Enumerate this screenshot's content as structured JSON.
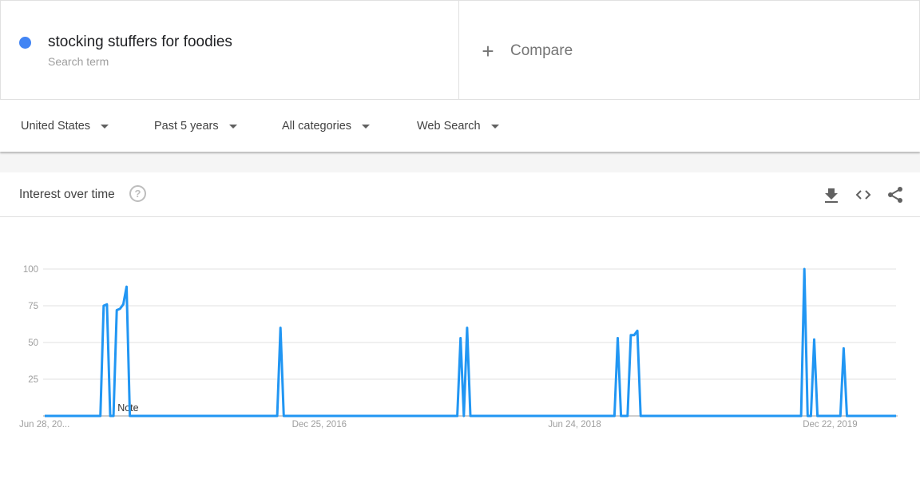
{
  "terms": [
    {
      "name": "stocking stuffers for foodies",
      "subtitle": "Search term",
      "color": "#4285f4"
    }
  ],
  "compare": {
    "icon": "plus-icon",
    "label": "Compare"
  },
  "filters": [
    {
      "label": "United States",
      "icon": "caret-down-icon"
    },
    {
      "label": "Past 5 years",
      "icon": "caret-down-icon"
    },
    {
      "label": "All categories",
      "icon": "caret-down-icon"
    },
    {
      "label": "Web Search",
      "icon": "caret-down-icon"
    }
  ],
  "card": {
    "title": "Interest over time",
    "help_icon": "help-circle-icon",
    "help_glyph": "?",
    "actions": [
      {
        "name": "download-icon"
      },
      {
        "name": "embed-code-icon"
      },
      {
        "name": "share-icon"
      }
    ]
  },
  "chart_data": {
    "type": "line",
    "title": "Interest over time",
    "xlabel": "",
    "ylabel": "",
    "ylim": [
      0,
      100
    ],
    "yticks": [
      25,
      50,
      75,
      100
    ],
    "grid": true,
    "series_color": "#2196f3",
    "x_tick_labels": [
      {
        "week": 0,
        "label": "Jun 28, 20..."
      },
      {
        "week": 78,
        "label": "Dec 25, 2016"
      },
      {
        "week": 156,
        "label": "Jun 24, 2018"
      },
      {
        "week": 234,
        "label": "Dec 22, 2019"
      }
    ],
    "total_weeks": 261,
    "series": [
      {
        "name": "stocking stuffers for foodies",
        "default_value": 0,
        "nonzero_points": [
          {
            "week": 18,
            "value": 75
          },
          {
            "week": 19,
            "value": 76
          },
          {
            "week": 22,
            "value": 72
          },
          {
            "week": 23,
            "value": 73
          },
          {
            "week": 24,
            "value": 76
          },
          {
            "week": 25,
            "value": 88
          },
          {
            "week": 72,
            "value": 60
          },
          {
            "week": 127,
            "value": 53
          },
          {
            "week": 129,
            "value": 60
          },
          {
            "week": 175,
            "value": 53
          },
          {
            "week": 179,
            "value": 55
          },
          {
            "week": 180,
            "value": 55
          },
          {
            "week": 181,
            "value": 58
          },
          {
            "week": 232,
            "value": 100
          },
          {
            "week": 235,
            "value": 52
          },
          {
            "week": 244,
            "value": 46
          }
        ]
      }
    ],
    "annotations": [
      {
        "week": 22,
        "label": "Note"
      }
    ]
  }
}
